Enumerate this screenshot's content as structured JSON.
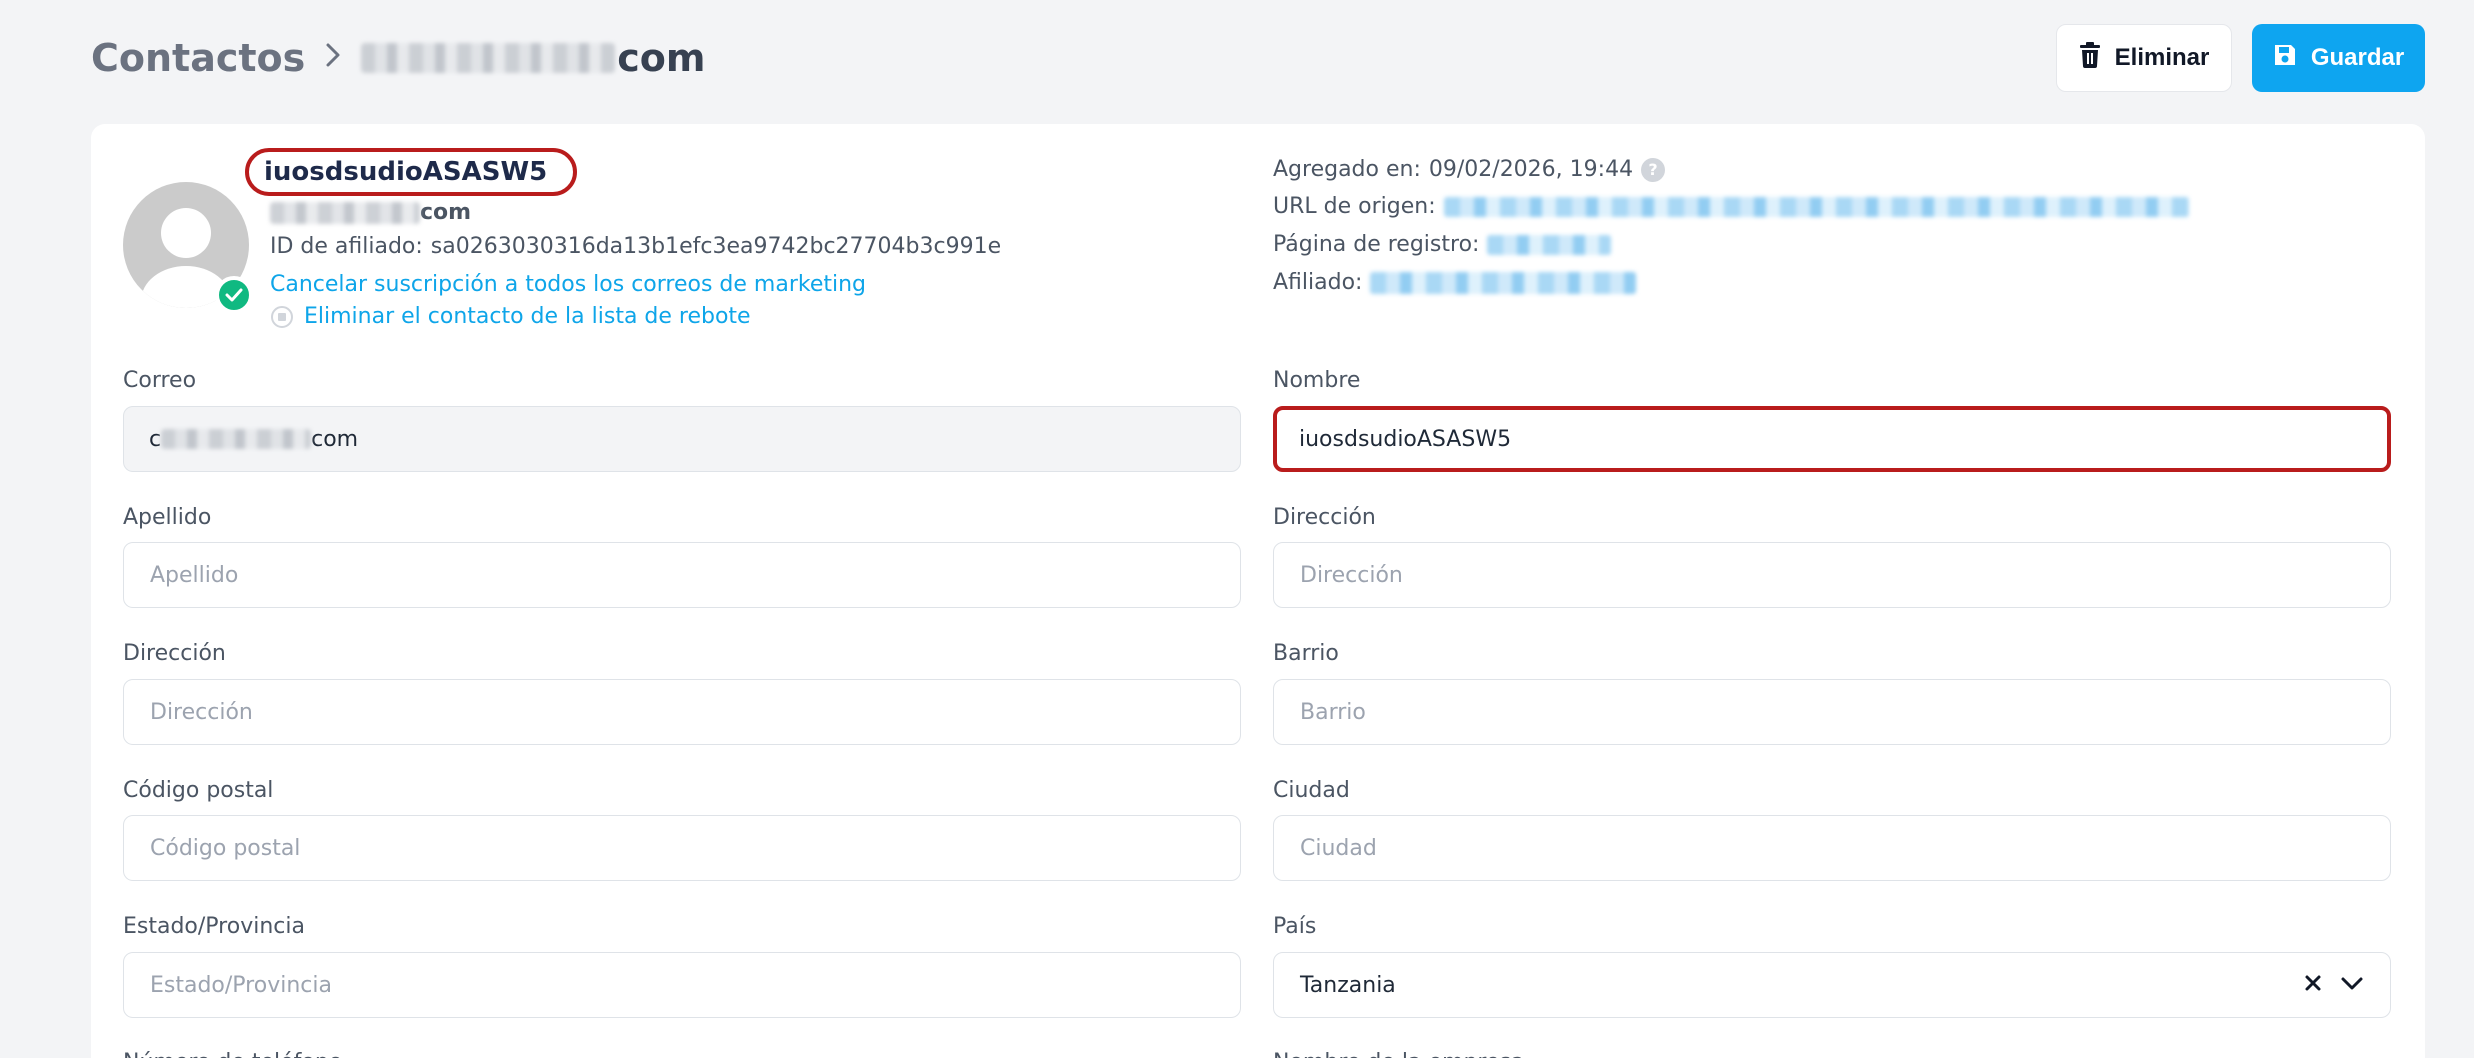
{
  "breadcrumb": {
    "root": "Contactos",
    "current_suffix": "com"
  },
  "toolbar": {
    "delete_label": "Eliminar",
    "save_label": "Guardar"
  },
  "profile": {
    "name": "iuosdsudioASASW5",
    "email_suffix": "com",
    "affiliate_id_label": "ID de afiliado:",
    "affiliate_id": "sa0263030316da13b1efc3ea9742bc27704b3c991e",
    "unsubscribe_link": "Cancelar suscripción a todos los correos de marketing",
    "remove_bounce_link": "Eliminar el contacto de la lista de rebote",
    "verified": true
  },
  "meta": {
    "added_label": "Agregado en:",
    "added_value": "09/02/2026, 19:44",
    "help": "?",
    "source_url_label": "URL de origen:",
    "signup_page_label": "Página de registro:",
    "affiliate_label": "Afiliado:"
  },
  "form": {
    "email": {
      "label": "Correo",
      "prefix": "c",
      "suffix": "com"
    },
    "first_name": {
      "label": "Nombre",
      "value": "iuosdsudioASASW5"
    },
    "last_name": {
      "label": "Apellido",
      "placeholder": "Apellido"
    },
    "address2": {
      "label": "Dirección",
      "placeholder": "Dirección"
    },
    "address": {
      "label": "Dirección",
      "placeholder": "Dirección"
    },
    "neighborhood": {
      "label": "Barrio",
      "placeholder": "Barrio"
    },
    "postal_code": {
      "label": "Código postal",
      "placeholder": "Código postal"
    },
    "city": {
      "label": "Ciudad",
      "placeholder": "Ciudad"
    },
    "state": {
      "label": "Estado/Provincia",
      "placeholder": "Estado/Provincia"
    },
    "country": {
      "label": "País",
      "value": "Tanzania"
    },
    "phone_partial": "Número de teléfono",
    "company_partial": "Nombre de la empresa"
  },
  "colors": {
    "accent": "#0ea5f0",
    "link": "#0ea5e9",
    "highlight": "#b91c1c",
    "success": "#10b981"
  }
}
